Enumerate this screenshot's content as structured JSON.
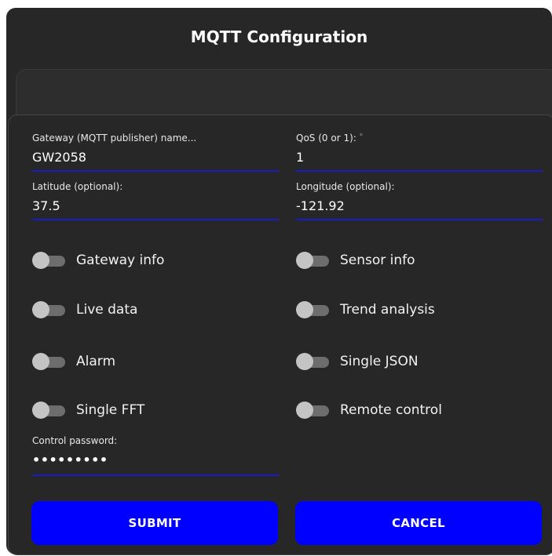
{
  "dialog": {
    "title": "MQTT Configuration"
  },
  "fields": {
    "gateway_name": {
      "label": "Gateway (MQTT publisher) name...",
      "value": "GW2058"
    },
    "qos": {
      "label": "QoS (0 or 1):",
      "required_mark": "*",
      "value": "1"
    },
    "latitude": {
      "label": "Latitude (optional):",
      "value": "37.5"
    },
    "longitude": {
      "label": "Longitude (optional):",
      "value": "-121.92"
    },
    "control_password": {
      "label": "Control password:",
      "value": "•••••••••"
    }
  },
  "toggles": {
    "gateway_info": {
      "label": "Gateway info",
      "state": "off"
    },
    "sensor_info": {
      "label": "Sensor info",
      "state": "off"
    },
    "live_data": {
      "label": "Live data",
      "state": "off"
    },
    "trend_analysis": {
      "label": "Trend analysis",
      "state": "off"
    },
    "alarm": {
      "label": "Alarm",
      "state": "off"
    },
    "single_json": {
      "label": "Single JSON",
      "state": "off"
    },
    "single_fft": {
      "label": "Single FFT",
      "state": "off"
    },
    "remote_control": {
      "label": "Remote control",
      "state": "off"
    }
  },
  "buttons": {
    "submit": "SUBMIT",
    "cancel": "CANCEL"
  },
  "colors": {
    "background": "#272727",
    "accent_blue": "#0000ff",
    "underline": "#1a1acc",
    "toggle_track": "#6d6d6d",
    "toggle_knob": "#c4c4c4"
  }
}
